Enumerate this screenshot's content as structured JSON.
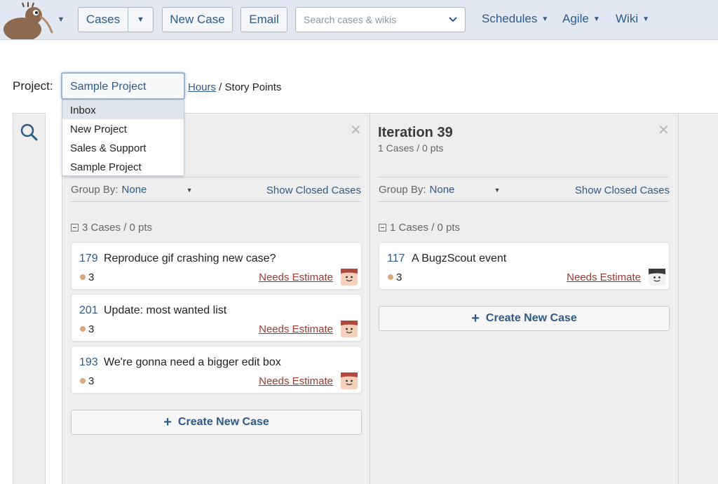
{
  "topbar": {
    "cases_label": "Cases",
    "new_case_label": "New Case",
    "email_label": "Email",
    "search_placeholder": "Search cases & wikis",
    "nav": {
      "schedules": "Schedules",
      "agile": "Agile",
      "wiki": "Wiki"
    }
  },
  "project": {
    "label": "Project:",
    "selected": "Sample Project",
    "options": [
      "Inbox",
      "New Project",
      "Sales & Support",
      "Sample Project"
    ],
    "metric_hours": "Hours",
    "metric_separator": " / ",
    "metric_story_points": "Story Points"
  },
  "columns": [
    {
      "title": "",
      "subtitle": "",
      "group_by_label": "Group By:",
      "group_by_value": "None",
      "show_closed": "Show Closed Cases",
      "group_summary": "3 Cases / 0 pts",
      "cards": [
        {
          "id": "179",
          "title": "Reproduce gif crashing new case?",
          "points": "3",
          "estimate": "Needs Estimate"
        },
        {
          "id": "201",
          "title": "Update: most wanted list",
          "points": "3",
          "estimate": "Needs Estimate"
        },
        {
          "id": "193",
          "title": "We're gonna need a bigger edit box",
          "points": "3",
          "estimate": "Needs Estimate"
        }
      ],
      "create_label": "Create New Case"
    },
    {
      "title": "Iteration 39",
      "subtitle": "1 Cases / 0 pts",
      "group_by_label": "Group By:",
      "group_by_value": "None",
      "show_closed": "Show Closed Cases",
      "group_summary": "1 Cases / 0 pts",
      "cards": [
        {
          "id": "117",
          "title": "A BugzScout event",
          "points": "3",
          "estimate": "Needs Estimate"
        }
      ],
      "create_label": "Create New Case"
    }
  ],
  "colors": {
    "topbar_bg": "#e2e8f1",
    "link_blue": "#2e5a8a",
    "estimate_red": "#9a3b32",
    "column_bg": "#eeeeee",
    "point_dot": "#d9a97e"
  },
  "icons": {
    "logo": "kiwi-bird-logo",
    "search": "magnifier-icon",
    "close": "close-icon",
    "collapse": "collapse-minus-icon",
    "avatar": "user-avatar-icon",
    "add": "plus-icon"
  }
}
